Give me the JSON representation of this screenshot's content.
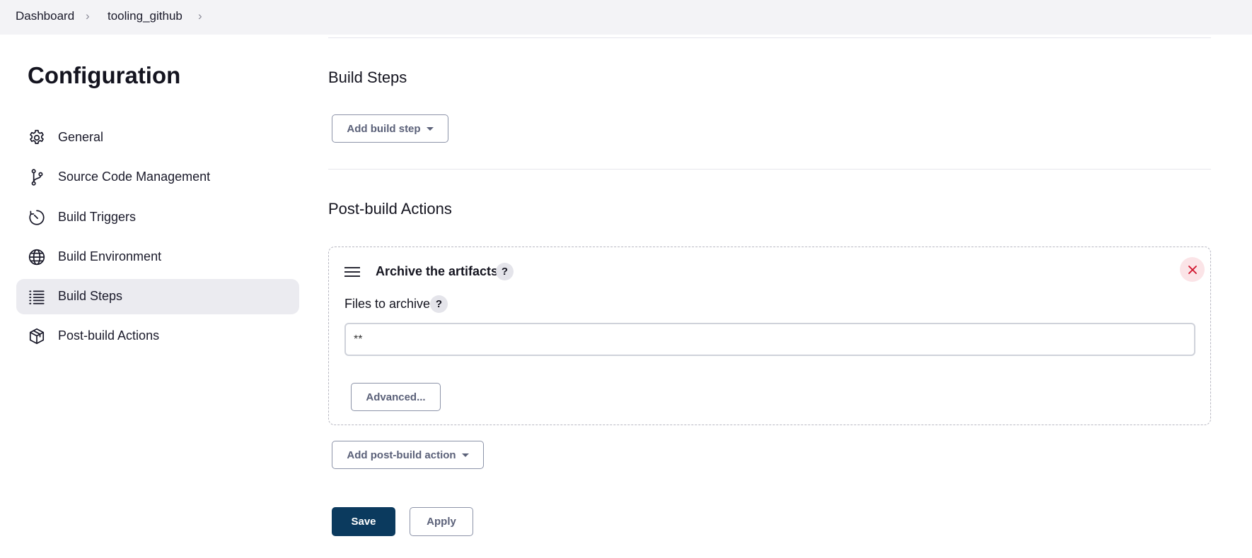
{
  "breadcrumb": {
    "items": [
      "Dashboard",
      "tooling_github"
    ]
  },
  "page": {
    "title": "Configuration"
  },
  "sidebar": {
    "items": [
      {
        "label": "General",
        "icon": "gear-icon"
      },
      {
        "label": "Source Code Management",
        "icon": "branch-icon"
      },
      {
        "label": "Build Triggers",
        "icon": "clock-icon"
      },
      {
        "label": "Build Environment",
        "icon": "globe-icon"
      },
      {
        "label": "Build Steps",
        "icon": "list-icon",
        "active": true
      },
      {
        "label": "Post-build Actions",
        "icon": "box-icon"
      }
    ]
  },
  "build_steps": {
    "title": "Build Steps",
    "add_button": "Add build step"
  },
  "post_build": {
    "title": "Post-build Actions",
    "card": {
      "title": "Archive the artifacts",
      "help": "?",
      "field_label": "Files to archive",
      "field_help": "?",
      "field_value": "**",
      "advanced_button": "Advanced..."
    },
    "add_button": "Add post-build action"
  },
  "footer": {
    "save": "Save",
    "apply": "Apply"
  },
  "colors": {
    "save_bg": "#0b3a5e",
    "close_icon": "#d0142c",
    "active_bg": "#ebebf0"
  }
}
